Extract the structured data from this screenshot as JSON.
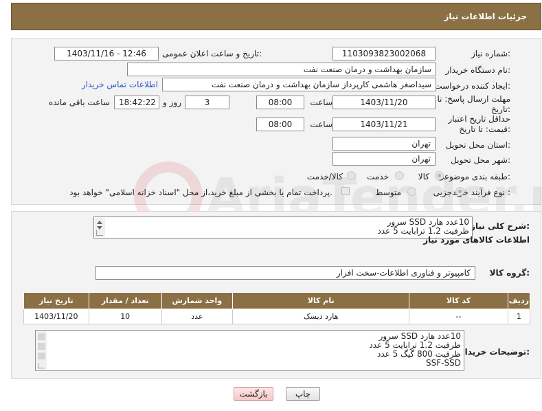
{
  "header": {
    "title": "جزئیات اطلاعات نیاز"
  },
  "need_number": {
    "label": "شماره نیاز:",
    "value": "1103093823002068"
  },
  "announce_datetime": {
    "label": "تاریخ و ساعت اعلان عمومی:",
    "value": "1403/11/16 - 12:46"
  },
  "buyer_org": {
    "label": "نام دستگاه خریدار:",
    "value": "سازمان بهداشت و درمان صنعت نفت"
  },
  "requester": {
    "label": "ایجاد کننده درخواست:",
    "value": "سیداصغر هاشمی کارپرداز سازمان بهداشت و درمان صنعت نفت",
    "contact_link": "اطلاعات تماس خریدار"
  },
  "reply_deadline": {
    "label": "مهلت ارسال پاسخ: تا تاریخ:",
    "date": "1403/11/20",
    "time_label": "ساعت",
    "time": "08:00",
    "days": "3",
    "days_label": "روز و",
    "remaining": "18:42:22",
    "remaining_label": "ساعت باقی مانده"
  },
  "price_validity": {
    "label": "حداقل تاریخ اعتبار قیمت: تا تاریخ:",
    "date": "1403/11/21",
    "time_label": "ساعت",
    "time": "08:00"
  },
  "delivery_province": {
    "label": "استان محل تحویل:",
    "value": "تهران"
  },
  "delivery_city": {
    "label": "شهر محل تحویل:",
    "value": "تهران"
  },
  "category": {
    "label": "طبقه بندی موضوعی:",
    "options": [
      "کالا",
      "خدمت",
      "کالا/خدمت"
    ],
    "selected": "کالا"
  },
  "purchase_process": {
    "label": "نوع فرآیند خرید :",
    "options": [
      "جزیی",
      "متوسط"
    ],
    "selected": "جزیی",
    "payment_note": "پرداخت تمام یا بخشی از مبلغ خرید،از محل \"اسناد خزانه اسلامی\" خواهد بود."
  },
  "general_description": {
    "label": "شرح کلی نیاز:",
    "lines": [
      "10عدد هارد SSD سرور",
      "ظرفیت 1.2 ترابایت 5 عدد"
    ]
  },
  "goods_info_title": "اطلاعات کالاهای مورد نیاز",
  "goods_group": {
    "label": "گروه کالا:",
    "value": "کامپیوتر و فناوری اطلاعات-سخت افزار"
  },
  "table": {
    "headers": [
      "ردیف",
      "کد کالا",
      "نام کالا",
      "واحد شمارش",
      "تعداد / مقدار",
      "تاریخ نیاز"
    ],
    "rows": [
      [
        "1",
        "--",
        "هارد دیسک",
        "عدد",
        "10",
        "1403/11/20"
      ]
    ]
  },
  "buyer_notes": {
    "label": "توضیحات خریدار:",
    "lines": [
      "10عدد هارد SSD سرور",
      "ظرفیت 1.2 ترابایت 5 عدد",
      "ظرفیت 800 گیگ 5 عدد",
      "SSF-SSD"
    ]
  },
  "buttons": {
    "print": "چاپ",
    "back": "بازگشت"
  },
  "watermark_text": "AriaTender.neT",
  "colors": {
    "header_bg": "#8b7046",
    "link": "#2a56c6",
    "back_btn": "#f8c8c8"
  }
}
